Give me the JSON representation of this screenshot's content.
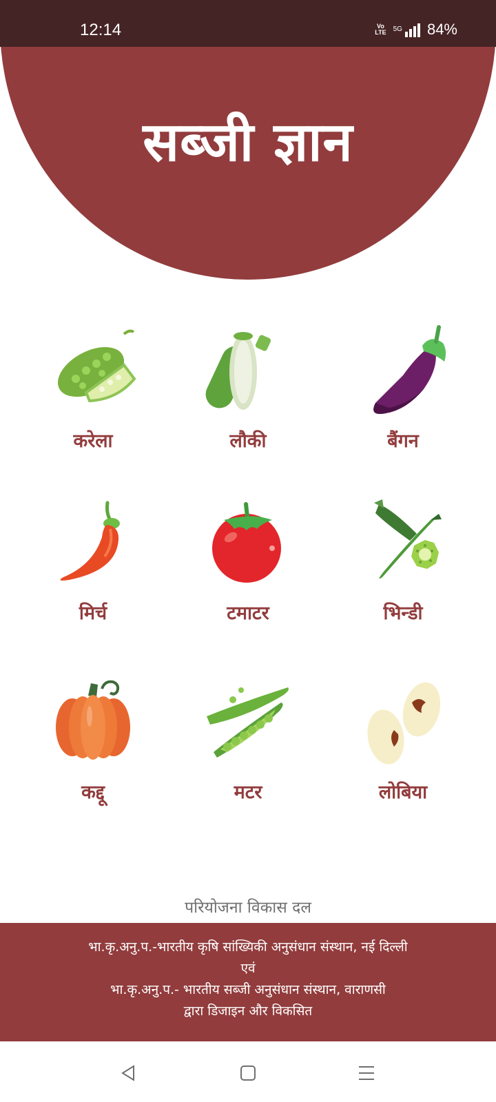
{
  "status_bar": {
    "time": "12:14",
    "volte_label": "Vo LTE",
    "network_label": "5G",
    "battery": "84%"
  },
  "header": {
    "title": "सब्जी ज्ञान"
  },
  "vegetables": [
    {
      "label": "करेला",
      "icon": "bitter-gourd-icon"
    },
    {
      "label": "लौकी",
      "icon": "bottle-gourd-icon"
    },
    {
      "label": "बैंगन",
      "icon": "eggplant-icon"
    },
    {
      "label": "मिर्च",
      "icon": "chili-icon"
    },
    {
      "label": "टमाटर",
      "icon": "tomato-icon"
    },
    {
      "label": "भिन्डी",
      "icon": "okra-icon"
    },
    {
      "label": "कद्दू",
      "icon": "pumpkin-icon"
    },
    {
      "label": "मटर",
      "icon": "peas-icon"
    },
    {
      "label": "लोबिया",
      "icon": "cowpea-icon"
    }
  ],
  "team_label": "परियोजना विकास दल",
  "footer": {
    "line1": "भा.कृ.अनु.प.-भारतीय कृषि सांख्यिकी अनुसंधान संस्थान, नई दिल्ली",
    "line2": "एवं",
    "line3": "भा.कृ.अनु.प.- भारतीय सब्जी अनुसंधान संस्थान, वाराणसी",
    "line4": "द्वारा डिजाइन और विकसित"
  },
  "colors": {
    "primary": "#923c3d",
    "status_bar": "#452425",
    "team_text": "#6f6f6f"
  },
  "nav": {
    "back": "back-icon",
    "home": "home-icon",
    "menu": "menu-icon"
  }
}
